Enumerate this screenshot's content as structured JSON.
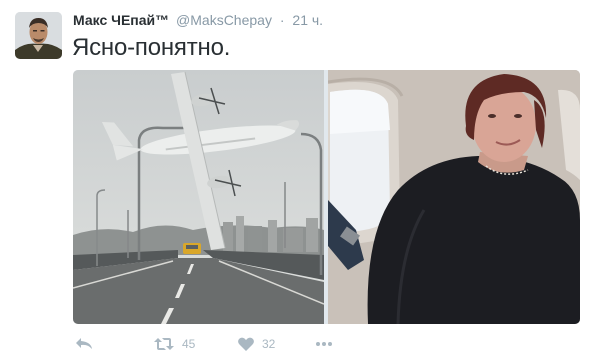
{
  "tweet": {
    "author": {
      "fullname": "Макс ЧЕпай™",
      "username": "@MaksChepay",
      "separator": "·",
      "timestamp": "21 ч."
    },
    "text": "Ясно-понятно.",
    "media": {
      "left_image": "airplane-crash-photo",
      "right_image": "woman-in-airplane-seat-photo"
    },
    "actions": {
      "reply_icon": "reply-icon",
      "retweet_icon": "retweet-icon",
      "retweet_count": "45",
      "like_icon": "heart-icon",
      "like_count": "32",
      "more_icon": "more-icon"
    }
  },
  "colors": {
    "text": "#292f33",
    "muted": "#8899a6",
    "action": "#aab8c2"
  }
}
